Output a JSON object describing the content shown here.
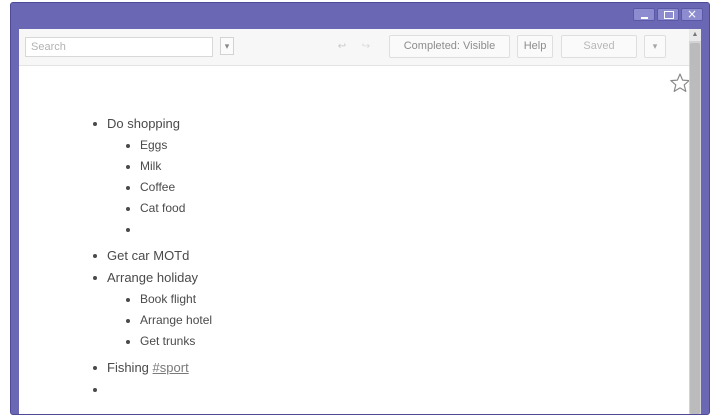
{
  "toolbar": {
    "search_placeholder": "Search",
    "search_options_icon": "dropdown-icon",
    "undo_icon": "undo-icon",
    "redo_icon": "redo-icon",
    "completed_label": "Completed: Visible",
    "help_label": "Help",
    "saved_label": "Saved",
    "menu_icon": "chevron-down-icon"
  },
  "window": {
    "minimize_icon": "minimize-icon",
    "maximize_icon": "maximize-icon",
    "close_icon": "close-icon"
  },
  "star_icon": "star-icon",
  "outline": {
    "items": [
      {
        "text": "Do shopping",
        "children": [
          "Eggs",
          "Milk",
          "Coffee",
          "Cat food",
          ""
        ]
      },
      {
        "text": "Get car MOTd"
      },
      {
        "text": "Arrange holiday",
        "children": [
          "Book flight",
          "Arrange hotel",
          "Get trunks"
        ]
      },
      {
        "text": "Fishing",
        "tag": "#sport"
      },
      {
        "text": ""
      }
    ]
  }
}
